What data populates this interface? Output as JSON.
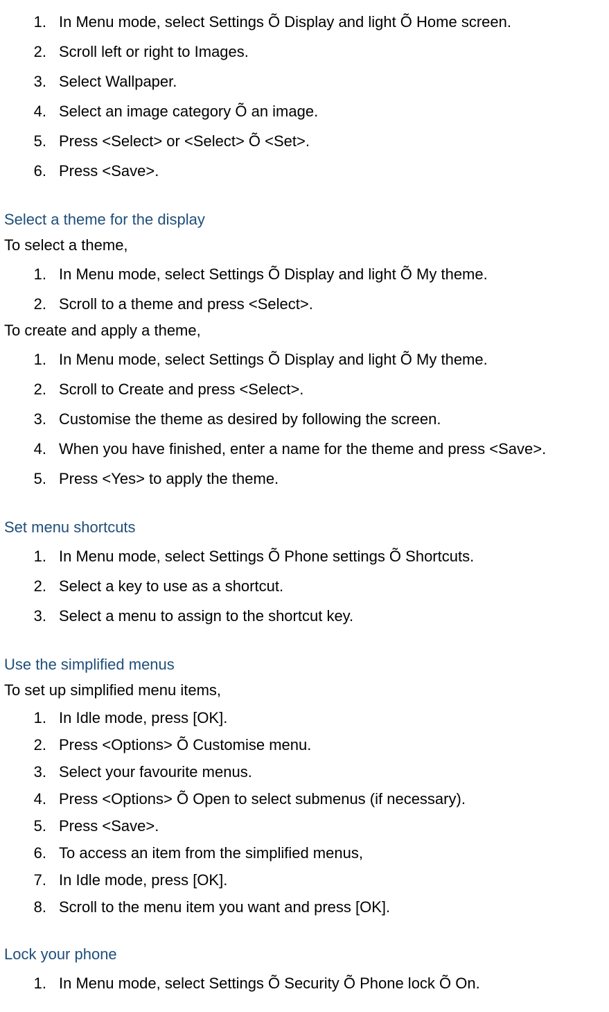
{
  "section1": {
    "items": [
      {
        "num": "1.",
        "text": "In Menu mode, select Settings Õ Display and light Õ Home screen."
      },
      {
        "num": "2.",
        "text": "Scroll left or right to Images."
      },
      {
        "num": "3.",
        "text": "Select Wallpaper."
      },
      {
        "num": "4.",
        "text": "Select an image category Õ an image."
      },
      {
        "num": "5.",
        "text": "Press <Select> or <Select> Õ <Set>."
      },
      {
        "num": "6.",
        "text": "Press <Save>."
      }
    ]
  },
  "section2": {
    "heading": "Select a theme for the display",
    "intro1": "To select a theme,",
    "list1": [
      {
        "num": "1.",
        "text": "In Menu mode, select Settings Õ Display and light Õ My theme."
      },
      {
        "num": "2.",
        "text": "Scroll to a theme and press <Select>."
      }
    ],
    "intro2": "To create and apply a theme,",
    "list2": [
      {
        "num": "1.",
        "text": "In Menu mode, select Settings Õ Display and light Õ My theme."
      },
      {
        "num": "2.",
        "text": "Scroll to Create and press <Select>."
      },
      {
        "num": "3.",
        "text": "Customise the theme as desired by following the screen."
      },
      {
        "num": "4.",
        "text": "When you have finished, enter a name for the theme and press <Save>."
      },
      {
        "num": "5.",
        "text": "Press <Yes> to apply the theme."
      }
    ]
  },
  "section3": {
    "heading": "Set menu shortcuts",
    "items": [
      {
        "num": "1.",
        "text": "In Menu mode, select Settings Õ Phone settings Õ Shortcuts."
      },
      {
        "num": "2.",
        "text": "Select a key to use as a shortcut."
      },
      {
        "num": "3.",
        "text": "Select a menu to assign to the shortcut key."
      }
    ]
  },
  "section4": {
    "heading": "Use the simplified menus",
    "intro": "To set up simplified menu items,",
    "items": [
      {
        "num": "1.",
        "text": "In Idle mode, press [OK]."
      },
      {
        "num": "2.",
        "text": "Press <Options> Õ Customise menu."
      },
      {
        "num": "3.",
        "text": "Select your favourite menus."
      },
      {
        "num": "4.",
        "text": "Press <Options> Õ Open to select submenus (if necessary)."
      },
      {
        "num": "5.",
        "text": "Press <Save>."
      },
      {
        "num": "6.",
        "text": "To access an item from the simplified menus,"
      },
      {
        "num": "7.",
        "text": "In Idle mode, press [OK]."
      },
      {
        "num": "8.",
        "text": "Scroll to the menu item you want and press [OK]."
      }
    ]
  },
  "section5": {
    "heading": "Lock your phone",
    "items": [
      {
        "num": "1.",
        "text": "In Menu mode, select Settings Õ Security Õ Phone lock Õ On."
      }
    ]
  }
}
